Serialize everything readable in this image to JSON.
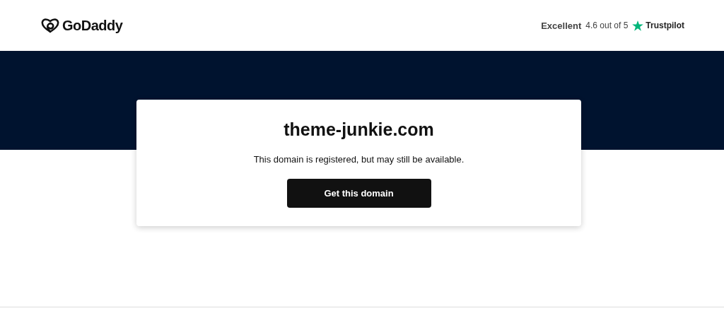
{
  "header": {
    "logo_text": "GoDaddy",
    "rating_label": "Excellent",
    "rating_score": "4.6 out of 5",
    "review_brand": "Trustpilot"
  },
  "card": {
    "domain": "theme-junkie.com",
    "message": "This domain is registered, but may still be available.",
    "button": "Get this domain"
  }
}
